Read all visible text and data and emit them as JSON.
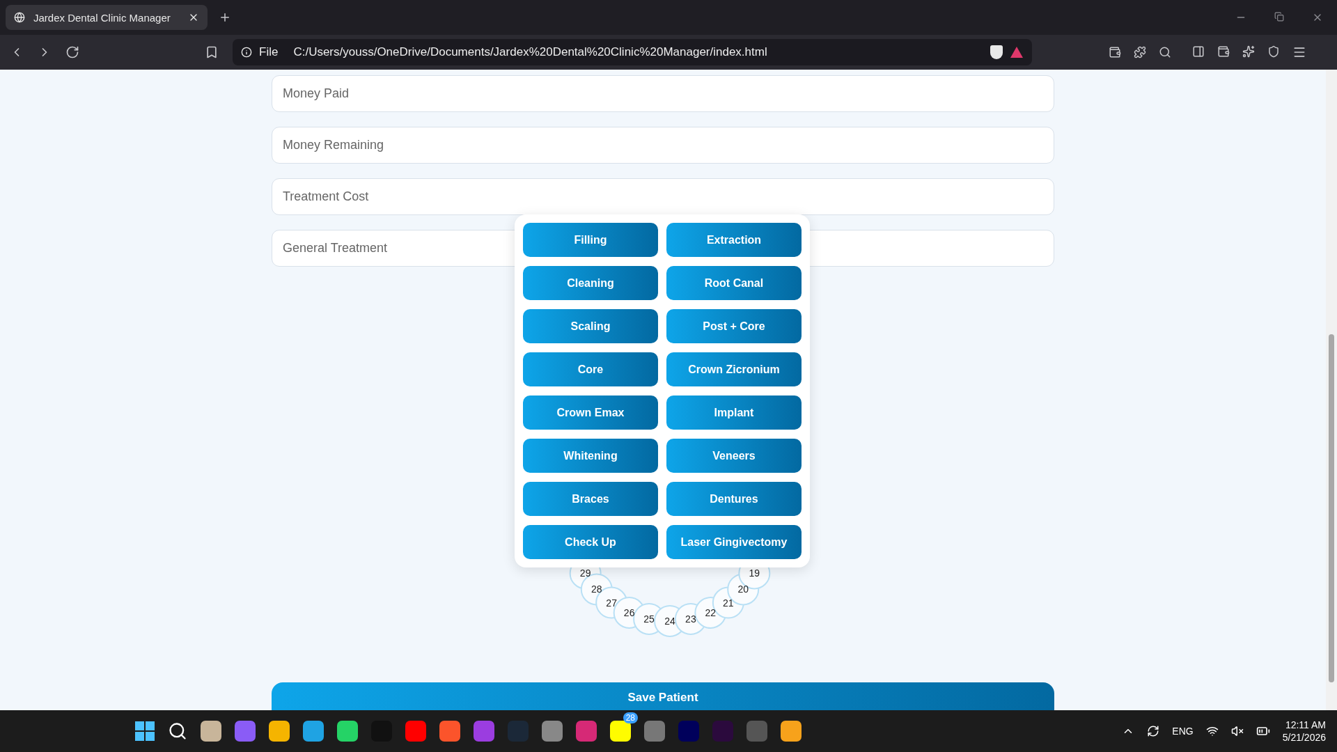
{
  "browser": {
    "tab_title": "Jardex Dental Clinic Manager",
    "address_scheme": "File",
    "url": "C:/Users/youss/OneDrive/Documents/Jardex%20Dental%20Clinic%20Manager/index.html"
  },
  "fields": [
    {
      "placeholder": "Money Paid"
    },
    {
      "placeholder": "Money Remaining"
    },
    {
      "placeholder": "Treatment Cost"
    },
    {
      "placeholder": "General Treatment"
    }
  ],
  "treatment_menu": [
    "Filling",
    "Extraction",
    "Cleaning",
    "Root Canal",
    "Scaling",
    "Post + Core",
    "Core",
    "Crown Zicronium",
    "Crown Emax",
    "Implant",
    "Whitening",
    "Veneers",
    "Braces",
    "Dentures",
    "Check Up",
    "Laser Gingivectomy"
  ],
  "teeth": [
    "29",
    "28",
    "27",
    "26",
    "25",
    "24",
    "23",
    "22",
    "21",
    "20",
    "19"
  ],
  "save_button": "Save Patient",
  "taskbar": {
    "badge": "28",
    "language": "ENG",
    "time": "12:11 AM",
    "date": "5/21/2026"
  }
}
